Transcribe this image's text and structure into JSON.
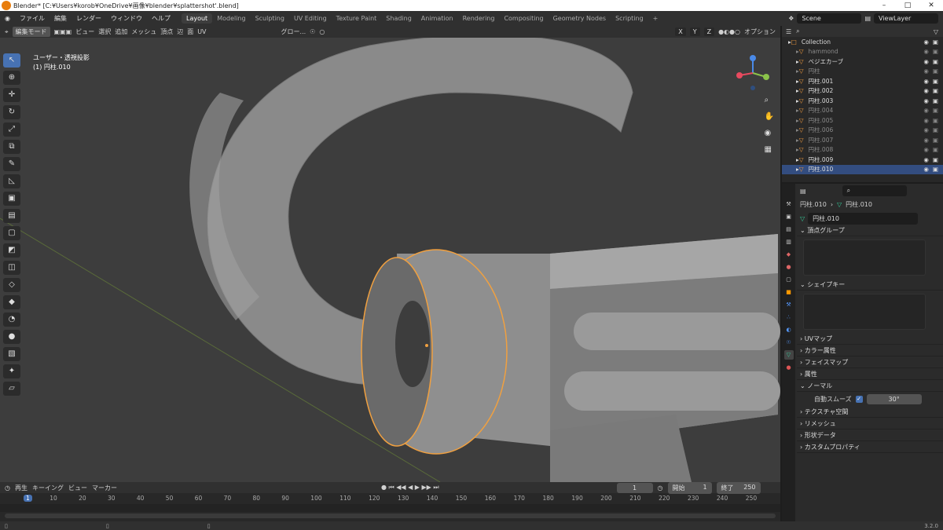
{
  "window": {
    "title": "Blender* [C:¥Users¥korob¥OneDrive¥画像¥blender¥splattershot'.blend]"
  },
  "menu": [
    "ファイル",
    "編集",
    "レンダー",
    "ウィンドウ",
    "ヘルプ"
  ],
  "workspaces": [
    "Layout",
    "Modeling",
    "Sculpting",
    "UV Editing",
    "Texture Paint",
    "Shading",
    "Animation",
    "Rendering",
    "Compositing",
    "Geometry Nodes",
    "Scripting"
  ],
  "active_workspace": "Layout",
  "scene": "Scene",
  "view_layer": "ViewLayer",
  "viewport": {
    "mode": "編集モード",
    "menu": [
      "ビュー",
      "選択",
      "追加",
      "メッシュ",
      "頂点",
      "辺",
      "面",
      "UV"
    ],
    "transform": "グロー...",
    "overlay_info_1": "ユーザー・透視投影",
    "overlay_info_2": "(1) 円柱.010",
    "options": "オプション",
    "axes": [
      "X",
      "Y",
      "Z"
    ]
  },
  "outliner": {
    "rows": [
      {
        "name": "Collection",
        "dim": false,
        "sel": false
      },
      {
        "name": "hammond",
        "dim": true,
        "sel": false
      },
      {
        "name": "ベジエカーブ",
        "dim": false,
        "sel": false
      },
      {
        "name": "円柱",
        "dim": true,
        "sel": false
      },
      {
        "name": "円柱.001",
        "dim": false,
        "sel": false
      },
      {
        "name": "円柱.002",
        "dim": false,
        "sel": false
      },
      {
        "name": "円柱.003",
        "dim": false,
        "sel": false
      },
      {
        "name": "円柱.004",
        "dim": true,
        "sel": false
      },
      {
        "name": "円柱.005",
        "dim": true,
        "sel": false
      },
      {
        "name": "円柱.006",
        "dim": true,
        "sel": false
      },
      {
        "name": "円柱.007",
        "dim": true,
        "sel": false
      },
      {
        "name": "円柱.008",
        "dim": true,
        "sel": false
      },
      {
        "name": "円柱.009",
        "dim": false,
        "sel": false
      },
      {
        "name": "円柱.010",
        "dim": false,
        "sel": true
      }
    ]
  },
  "properties": {
    "breadcrumb_obj": "円柱.010",
    "breadcrumb_mesh": "円柱.010",
    "mesh_name": "円柱.010",
    "vertex_groups": "頂点グループ",
    "shape_keys": "シェイプキー",
    "sections": [
      "UVマップ",
      "カラー属性",
      "フェイスマップ",
      "属性"
    ],
    "normals": "ノーマル",
    "auto_smooth": "自動スムーズ",
    "angle": "30°",
    "sections2": [
      "テクスチャ空間",
      "リメッシュ",
      "形状データ",
      "カスタムプロパティ"
    ]
  },
  "timeline": {
    "menu": [
      "再生",
      "キーイング",
      "ビュー",
      "マーカー"
    ],
    "current": "1",
    "start_label": "開始",
    "start": "1",
    "end_label": "終了",
    "end": "250",
    "ticks": [
      "1",
      "10",
      "20",
      "30",
      "40",
      "50",
      "60",
      "70",
      "80",
      "90",
      "100",
      "110",
      "120",
      "130",
      "140",
      "150",
      "160",
      "170",
      "180",
      "190",
      "200",
      "210",
      "220",
      "230",
      "240",
      "250"
    ]
  },
  "status": {
    "version": "3.2.0"
  }
}
